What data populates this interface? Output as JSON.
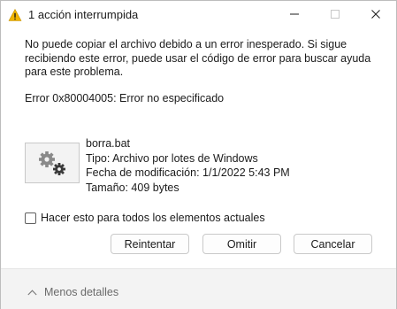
{
  "window": {
    "title": "1 acción interrumpida",
    "title_icon": "warning-icon",
    "controls": {
      "minimize": "minimize-icon",
      "maximize": "maximize-icon",
      "close": "close-icon"
    }
  },
  "dialog": {
    "message": "No puede copiar el archivo debido a un error inesperado. Si sigue recibiendo este error, puede usar el código de error para buscar ayuda para este problema.",
    "error_text": "Error 0x80004005: Error no especificado",
    "file": {
      "icon": "gear-file-icon",
      "name": "borra.bat",
      "type": "Tipo: Archivo por lotes de Windows",
      "modified": "Fecha de modificación: 1/1/2022 5:43 PM",
      "size": "Tamaño: 409 bytes"
    },
    "apply_all": {
      "label": "Hacer esto para todos los elementos actuales",
      "checked": false
    },
    "buttons": {
      "retry": "Reintentar",
      "skip": "Omitir",
      "cancel": "Cancelar"
    }
  },
  "footer": {
    "details_label": "Menos detalles",
    "details_icon": "chevron-up-icon"
  },
  "colors": {
    "warning": "#f0b400",
    "footer_bg": "#f3f3f3",
    "border": "#c9c9c9"
  }
}
